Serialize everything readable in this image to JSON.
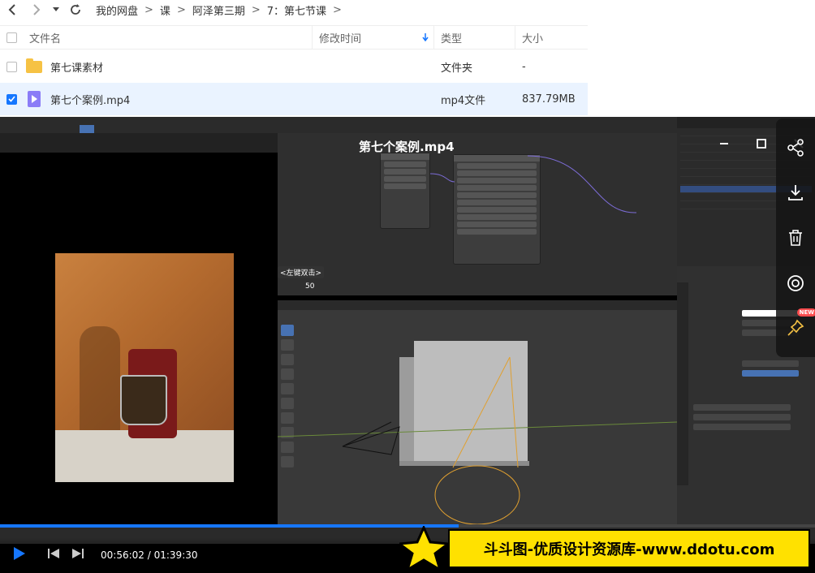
{
  "nav": {
    "back_icon": "chevron-left-icon",
    "forward_icon": "chevron-right-icon",
    "history_icon": "caret-down-icon",
    "refresh_icon": "refresh-icon",
    "breadcrumbs": [
      "我的网盘",
      "课",
      "阿泽第三期",
      "7：第七节课"
    ],
    "separator": ">"
  },
  "list": {
    "headers": {
      "name": "文件名",
      "modified": "修改时间",
      "type": "类型",
      "size": "大小"
    },
    "rows": [
      {
        "name": "第七课素材",
        "type": "文件夹",
        "size": "-",
        "icon": "folder-icon",
        "selected": false
      },
      {
        "name": "第七个案例.mp4",
        "type": "mp4文件",
        "size": "837.79MB",
        "icon": "video-file-icon",
        "selected": true
      }
    ]
  },
  "player": {
    "title": "第七个案例.mp4",
    "hint_label": "<左键双击>",
    "hint_value": "50",
    "current_time": "00:56:02",
    "separator": "/",
    "total_time": "01:39:30",
    "progress": 0.563,
    "new_badge": "NEW"
  },
  "watermark": {
    "text": "斗斗图-优质设计资源库-www.ddotu.com"
  },
  "colors": {
    "accent": "#1677ff",
    "selected_row": "#eaf3ff",
    "folder": "#f6c244",
    "video_file": "#8b7cf7",
    "watermark_bg": "#ffe100"
  }
}
